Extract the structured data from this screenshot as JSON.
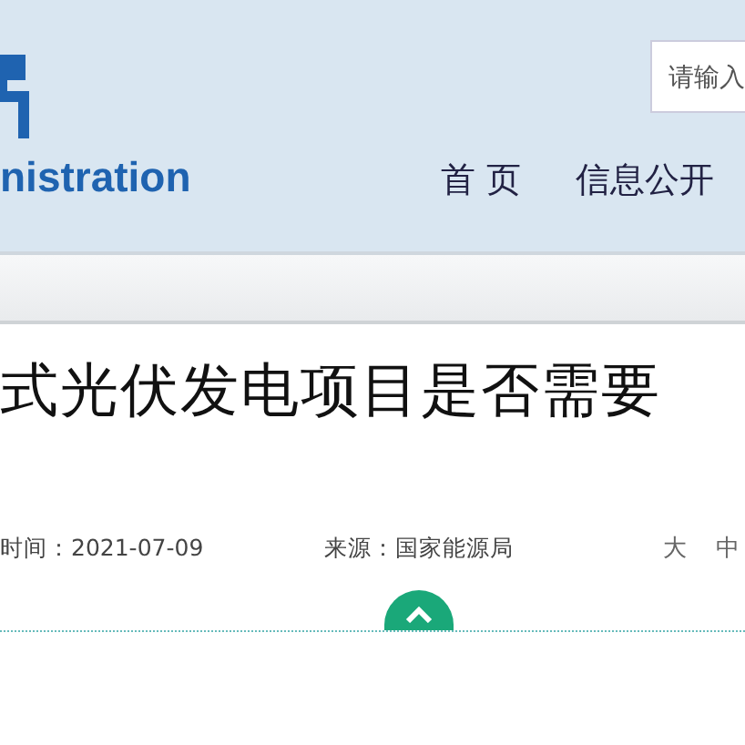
{
  "header": {
    "logo_text": "nistration",
    "search": {
      "placeholder": "请输入"
    },
    "nav": [
      {
        "label": "首 页"
      },
      {
        "label": "信息公开"
      }
    ]
  },
  "article": {
    "title": "式光伏发电项目是否需要",
    "meta": {
      "time": "时间：2021-07-09",
      "source": "来源：国家能源局",
      "font_sizes": [
        {
          "label": "大"
        },
        {
          "label": "中"
        }
      ]
    }
  }
}
